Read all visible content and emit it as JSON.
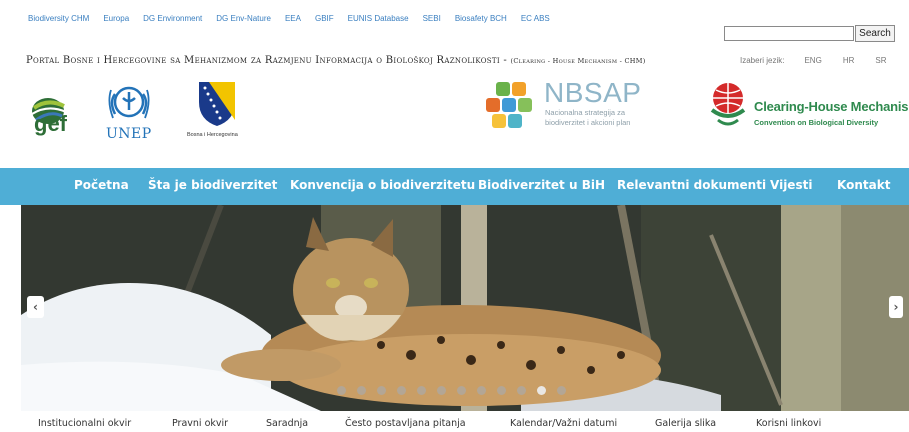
{
  "top_links": [
    "Biodiversity CHM",
    "Europa",
    "DG Environment",
    "DG Env-Nature",
    "EEA",
    "GBIF",
    "EUNIS Database",
    "SEBI",
    "Biosafety BCH",
    "EC ABS"
  ],
  "search": {
    "value": "",
    "button_label": "Search"
  },
  "portal_title": "Portal Bosne i Hercegovine sa Mehanizmom za Razmjenu Informacija o Biološkoj Raznolikosti - ",
  "portal_title_sub": "(Clearing - House Mechanism - CHM)",
  "language": {
    "label": "Izaberi jezik:",
    "options": [
      "ENG",
      "HR",
      "SR"
    ]
  },
  "logos": {
    "gef": "gef",
    "unep": "UNEP",
    "bih": "Bosna i Hercegovina",
    "nbsap_title": "NBSAP",
    "nbsap_sub": "Nacionalna strategija za biodiverzitet i akcioni plan",
    "chm_title": "Clearing-House Mechanism",
    "chm_sub": "Convention on Biological Diversity"
  },
  "nav": [
    "Početna",
    "Šta je biodiverzitet",
    "Konvencija o biodiverzitetu",
    "Biodiverzitet u BiH",
    "Relevantni dokumenti",
    "Vijesti",
    "Kontakt"
  ],
  "slider": {
    "prev_label": "‹",
    "next_label": "›",
    "dot_count": 12,
    "active_dot": 10
  },
  "bottom_links": [
    "Institucionalni okvir",
    "Pravni okvir",
    "Saradnja",
    "Često postavljana pitanja",
    "Kalendar/Važni datumi",
    "Galerija slika",
    "Korisni linkovi"
  ],
  "colors": {
    "nav_bg": "#4faed6",
    "link": "#3a7fc0",
    "chm_green": "#2f8a4e",
    "unep_blue": "#2373b8"
  }
}
